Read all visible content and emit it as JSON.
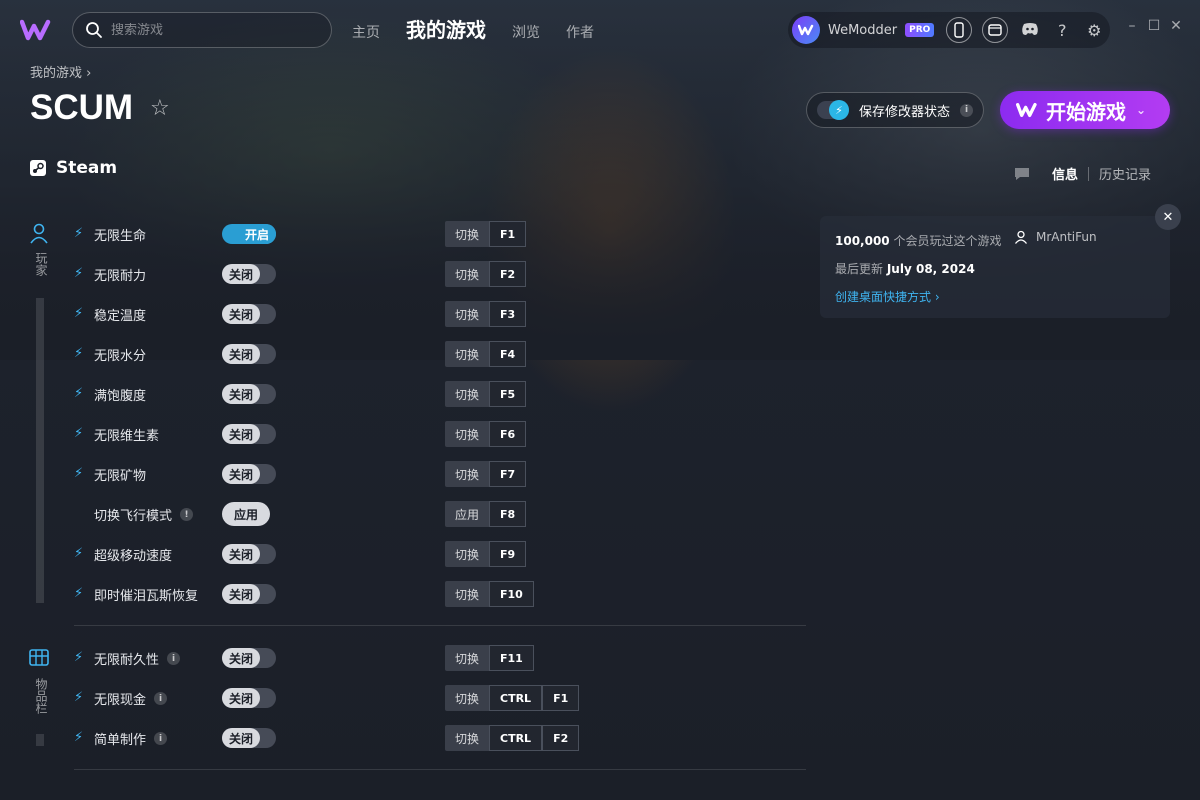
{
  "app": {
    "name": "WeModder",
    "pro_badge": "PRO",
    "accent": "#8c2bf0",
    "link_color": "#3fb4f0"
  },
  "search": {
    "placeholder": "搜索游戏"
  },
  "nav": {
    "home": "主页",
    "my_games": "我的游戏",
    "browse": "浏览",
    "creators": "作者"
  },
  "window": {
    "minimize": "–",
    "maximize": "☐",
    "close": "✕"
  },
  "breadcrumb": "我的游戏 ›",
  "game": {
    "title": "SCUM",
    "platform": "Steam"
  },
  "save_state": {
    "label": "保存修改器状态",
    "enabled": true
  },
  "play_button": {
    "label": "开始游戏"
  },
  "tabs": {
    "info": "信息",
    "history": "历史记录"
  },
  "info_card": {
    "members_count": "100,000",
    "members_text": "个会员玩过这个游戏",
    "author": "MrAntiFun",
    "updated_label": "最后更新",
    "updated_date": "July 08, 2024",
    "shortcut_link": "创建桌面快捷方式 ›"
  },
  "categories": {
    "player": "玩家",
    "inventory": "物品栏"
  },
  "labels": {
    "on": "开启",
    "off": "关闭",
    "apply": "应用",
    "toggle": "切换",
    "ctrl": "CTRL"
  },
  "cheats": [
    {
      "name": "无限生命",
      "state": "开启",
      "action": "切换",
      "key": "F1"
    },
    {
      "name": "无限耐力",
      "state": "关闭",
      "action": "切换",
      "key": "F2"
    },
    {
      "name": "稳定温度",
      "state": "关闭",
      "action": "切换",
      "key": "F3"
    },
    {
      "name": "无限水分",
      "state": "关闭",
      "action": "切换",
      "key": "F4"
    },
    {
      "name": "满饱腹度",
      "state": "关闭",
      "action": "切换",
      "key": "F5"
    },
    {
      "name": "无限维生素",
      "state": "关闭",
      "action": "切换",
      "key": "F6"
    },
    {
      "name": "无限矿物",
      "state": "关闭",
      "action": "切换",
      "key": "F7"
    },
    {
      "name": "切换飞行模式",
      "state": "应用",
      "action": "应用",
      "key": "F8"
    },
    {
      "name": "超级移动速度",
      "state": "关闭",
      "action": "切换",
      "key": "F9"
    },
    {
      "name": "即时催泪瓦斯恢复",
      "state": "关闭",
      "action": "切换",
      "key": "F10"
    },
    {
      "name": "无限耐久性",
      "state": "关闭",
      "action": "切换",
      "key": "F11"
    },
    {
      "name": "无限现金",
      "state": "关闭",
      "action": "切换",
      "mod": "CTRL",
      "key": "F1"
    },
    {
      "name": "简单制作",
      "state": "关闭",
      "action": "切换",
      "mod": "CTRL",
      "key": "F2"
    }
  ]
}
